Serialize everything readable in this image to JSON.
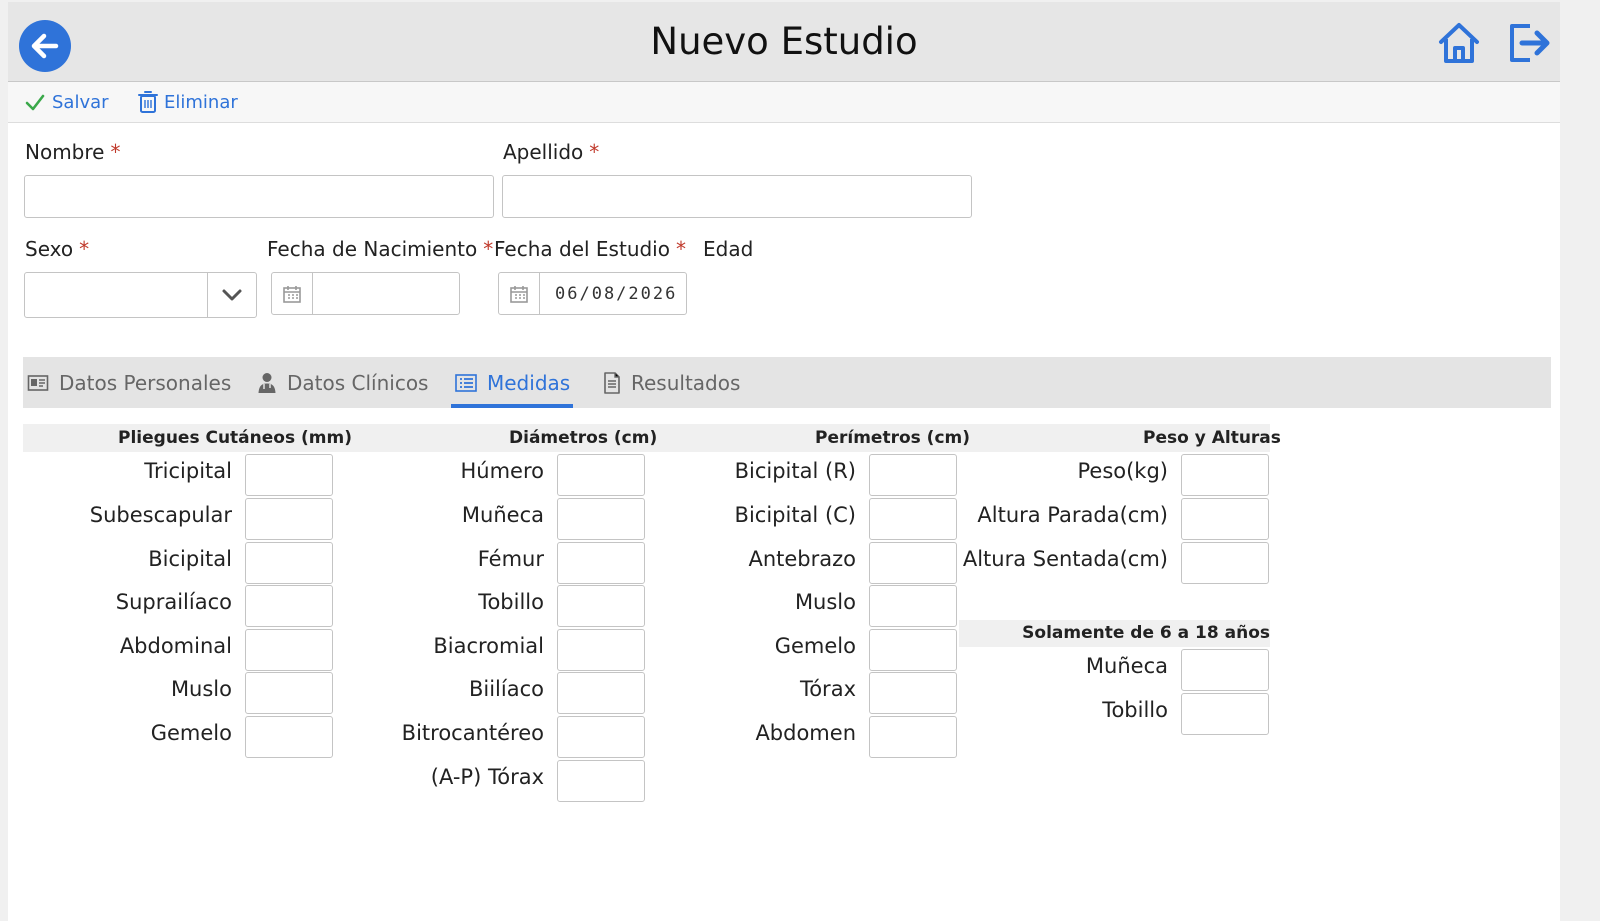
{
  "header": {
    "title": "Nuevo Estudio"
  },
  "toolbar": {
    "save_label": "Salvar",
    "delete_label": "Eliminar"
  },
  "form": {
    "nombre_label": "Nombre",
    "apellido_label": "Apellido",
    "sexo_label": "Sexo",
    "fecha_nac_label": "Fecha de Nacimiento",
    "fecha_estudio_label": "Fecha del Estudio",
    "fecha_estudio_value": "06/08/2026",
    "edad_label": "Edad",
    "required_mark": "*"
  },
  "tabs": [
    {
      "label": "Datos Personales",
      "icon": "id-card-icon"
    },
    {
      "label": "Datos Clínicos",
      "icon": "doctor-icon"
    },
    {
      "label": "Medidas",
      "icon": "list-icon",
      "active": true
    },
    {
      "label": "Resultados",
      "icon": "document-icon"
    }
  ],
  "measures": {
    "pliegues": {
      "title": "Pliegues Cutáneos (mm)",
      "items": [
        "Tricipital",
        "Subescapular",
        "Bicipital",
        "Suprailíaco",
        "Abdominal",
        "Muslo",
        "Gemelo"
      ]
    },
    "diametros": {
      "title": "Diámetros (cm)",
      "items": [
        "Húmero",
        "Muñeca",
        "Fémur",
        "Tobillo",
        "Biacromial",
        "Biilíaco",
        "Bitrocantéreo",
        "(A-P) Tórax"
      ]
    },
    "perimetros": {
      "title": "Perímetros (cm)",
      "items": [
        "Bicipital (R)",
        "Bicipital (C)",
        "Antebrazo",
        "Muslo",
        "Gemelo",
        "Tórax",
        "Abdomen"
      ]
    },
    "peso": {
      "title": "Peso y Alturas",
      "items": [
        "Peso(kg)",
        "Altura Parada(cm)",
        "Altura Sentada(cm)"
      ]
    },
    "solamente": {
      "title": "Solamente de 6 a 18 años",
      "items": [
        "Muñeca",
        "Tobillo"
      ]
    }
  },
  "colors": {
    "accent": "#2f73d9",
    "required": "#c0392b",
    "header_bg": "#e6e6e6"
  }
}
